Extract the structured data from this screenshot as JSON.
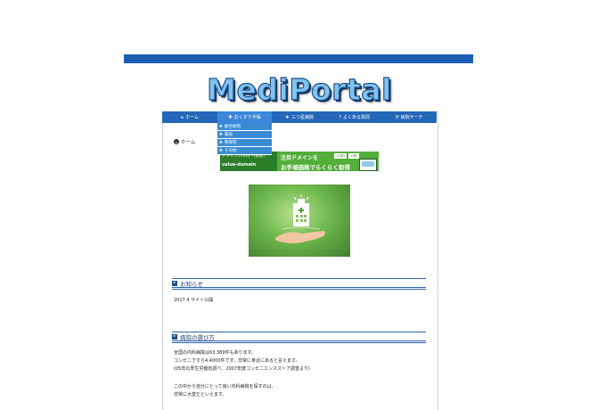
{
  "site": {
    "logo": "MediPortal"
  },
  "nav": [
    {
      "icon": "home-icon",
      "glyph": "⌂",
      "label": "ホーム"
    },
    {
      "icon": "pill-icon",
      "glyph": "✚",
      "label": "おくすり手帳"
    },
    {
      "icon": "star-icon",
      "glyph": "★",
      "label": "三つ星病院"
    },
    {
      "icon": "question-icon",
      "glyph": "?",
      "label": "よくある質問"
    },
    {
      "icon": "search-icon",
      "glyph": "⚲",
      "label": "病院サーチ"
    }
  ],
  "dropdown": [
    "総合病院",
    "薬局",
    "整骨院",
    "その他"
  ],
  "breadcrumb": {
    "label": "ホーム"
  },
  "banner": {
    "small": "ドメイン570円〜(税抜)",
    "brand": "value-domain",
    "headline": "注目ドメインを",
    "tags": [
      ".com",
      ".net"
    ],
    "sub": "お手頃価格でらくらく取得"
  },
  "news": {
    "title": "お知らせ",
    "items": [
      "2017.4 サイト公開"
    ]
  },
  "howto": {
    "title": "病院の選び方",
    "lines": [
      "全国の内科病院は63,389件もあります。",
      "コンビニですら4,4000件です。非常に身近にあると言えます。",
      "(05年の厚生労働省調べ、2007年度コンビニエンスストア調査より)",
      "",
      "この中から自分にとって良い内科病院を探すのは、",
      "非常に大変だといえます。"
    ]
  }
}
